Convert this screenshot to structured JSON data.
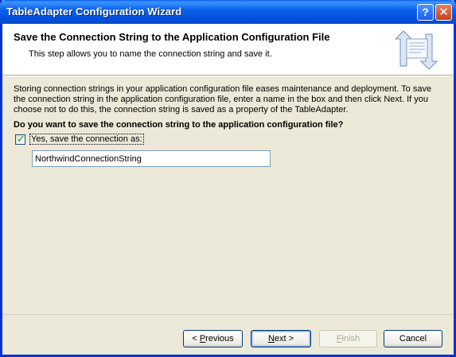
{
  "window": {
    "title": "TableAdapter Configuration Wizard",
    "help_glyph": "?",
    "close_glyph": "✕"
  },
  "header": {
    "title": "Save the Connection String to the Application Configuration File",
    "subtitle": "This step allows you to name the connection string and save it."
  },
  "body": {
    "description": "Storing connection strings in your application configuration file eases maintenance and deployment. To save the connection string in the application configuration file, enter a name in the box and then click Next. If you choose not to do this, the connection string is saved as a property of the TableAdapter.",
    "question": "Do you want to save the connection string to the application configuration file?",
    "save_checkbox": {
      "checked": true,
      "label": "Yes, save the connection as:"
    },
    "connection_name": "NorthwindConnectionString"
  },
  "buttons": {
    "previous_prefix": "< ",
    "previous_mnemonic": "P",
    "previous_rest": "revious",
    "next_mnemonic": "N",
    "next_rest": "ext >",
    "finish_mnemonic": "F",
    "finish_rest": "inish",
    "cancel": "Cancel",
    "finish_enabled": false
  },
  "icons": {
    "header_graphic": "connection-arrows-icon",
    "check": "checkmark-icon"
  },
  "colors": {
    "titlebar": "#0553e0",
    "dialog_bg": "#ece9d8",
    "header_bg": "#ffffff",
    "checkmark": "#21a121"
  }
}
